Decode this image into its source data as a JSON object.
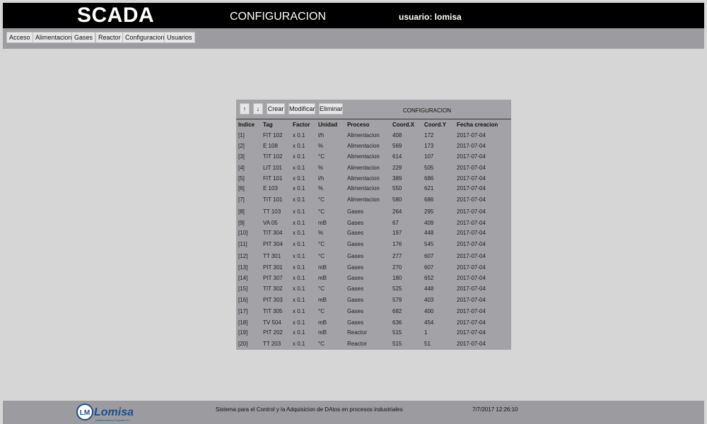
{
  "header": {
    "app_title": "SCADA",
    "page_heading": "CONFIGURACION",
    "user_label": "usuario: lomisa"
  },
  "menu": [
    {
      "label": "Acceso"
    },
    {
      "label": "Alimentacion"
    },
    {
      "label": "Gases"
    },
    {
      "label": "Reactor"
    },
    {
      "label": "Configuracion"
    },
    {
      "label": "Usuarios"
    }
  ],
  "toolbar": {
    "up_label": "↑",
    "down_label": "↓",
    "create_label": "Crear",
    "modify_label": "Modificar",
    "delete_label": "Eliminar",
    "panel_title": "CONFIGURACION"
  },
  "table": {
    "columns": [
      "Indice",
      "Tag",
      "Factor",
      "Unidad",
      "Proceso",
      "Coord.X",
      "Coord.Y",
      "Fecha creacion"
    ],
    "rows": [
      {
        "indice": "[1]",
        "tag": "FIT 102",
        "factor": "x 0.1",
        "unidad": "l/h",
        "proceso": "Alimentacion",
        "x": "408",
        "y": "172",
        "fecha": "2017-07-04"
      },
      {
        "indice": "[2]",
        "tag": "E 108",
        "factor": "x 0.1",
        "unidad": "%",
        "proceso": "Alimentacion",
        "x": "569",
        "y": "173",
        "fecha": "2017-07-04"
      },
      {
        "indice": "[3]",
        "tag": "TIT 102",
        "factor": "x 0.1",
        "unidad": "°C",
        "proceso": "Alimentacion",
        "x": "614",
        "y": "107",
        "fecha": "2017-07-04"
      },
      {
        "indice": "[4]",
        "tag": "LIT 101",
        "factor": "x 0.1",
        "unidad": "%",
        "proceso": "Alimentacion",
        "x": "229",
        "y": "505",
        "fecha": "2017-07-04"
      },
      {
        "indice": "[5]",
        "tag": "FIT 101",
        "factor": "x 0.1",
        "unidad": "l/h",
        "proceso": "Alimentacion",
        "x": "389",
        "y": "686",
        "fecha": "2017-07-04"
      },
      {
        "indice": "[6]",
        "tag": "E 103",
        "factor": "x 0.1",
        "unidad": "%",
        "proceso": "Alimentacion",
        "x": "550",
        "y": "621",
        "fecha": "2017-07-04"
      },
      {
        "indice": "[7]",
        "tag": "TIT 101",
        "factor": "x 0.1",
        "unidad": "°C",
        "proceso": "Alimentacion",
        "x": "580",
        "y": "686",
        "fecha": "2017-07-04"
      },
      {
        "indice": "[8]",
        "tag": "TT 103",
        "factor": "x 0.1",
        "unidad": "°C",
        "proceso": "Gases",
        "x": "264",
        "y": "295",
        "fecha": "2017-07-04"
      },
      {
        "indice": "[9]",
        "tag": "VA 05",
        "factor": "x 0.1",
        "unidad": "mB",
        "proceso": "Gases",
        "x": "67",
        "y": "409",
        "fecha": "2017-07-04"
      },
      {
        "indice": "[10]",
        "tag": "TIT 304",
        "factor": "x 0.1",
        "unidad": "%",
        "proceso": "Gases",
        "x": "197",
        "y": "448",
        "fecha": "2017-07-04"
      },
      {
        "indice": "[11]",
        "tag": "PIT 304",
        "factor": "x 0.1",
        "unidad": "°C",
        "proceso": "Gases",
        "x": "176",
        "y": "545",
        "fecha": "2017-07-04"
      },
      {
        "indice": "[12]",
        "tag": "TT 301",
        "factor": "x 0.1",
        "unidad": "°C",
        "proceso": "Gases",
        "x": "277",
        "y": "607",
        "fecha": "2017-07-04"
      },
      {
        "indice": "[13]",
        "tag": "PIT 301",
        "factor": "x 0.1",
        "unidad": "mB",
        "proceso": "Gases",
        "x": "270",
        "y": "607",
        "fecha": "2017-07-04"
      },
      {
        "indice": "[14]",
        "tag": "PIT 307",
        "factor": "x 0.1",
        "unidad": "mB",
        "proceso": "Gases",
        "x": "180",
        "y": "652",
        "fecha": "2017-07-04"
      },
      {
        "indice": "[15]",
        "tag": "TIT 302",
        "factor": "x 0.1",
        "unidad": "°C",
        "proceso": "Gases",
        "x": "525",
        "y": "448",
        "fecha": "2017-07-04"
      },
      {
        "indice": "[16]",
        "tag": "PIT 303",
        "factor": "x 0.1",
        "unidad": "mB",
        "proceso": "Gases",
        "x": "579",
        "y": "403",
        "fecha": "2017-07-04"
      },
      {
        "indice": "[17]",
        "tag": "TIT 305",
        "factor": "x 0.1",
        "unidad": "°C",
        "proceso": "Gases",
        "x": "682",
        "y": "400",
        "fecha": "2017-07-04"
      },
      {
        "indice": "[18]",
        "tag": "TV 504",
        "factor": "x 0.1",
        "unidad": "mB",
        "proceso": "Gases",
        "x": "636",
        "y": "454",
        "fecha": "2017-07-04"
      },
      {
        "indice": "[19]",
        "tag": "PIT 202",
        "factor": "x 0.1",
        "unidad": "mB",
        "proceso": "Reactor",
        "x": "515",
        "y": "1",
        "fecha": "2017-07-04"
      },
      {
        "indice": "[20]",
        "tag": "TT 203",
        "factor": "x 0.1",
        "unidad": "°C",
        "proceso": "Reactor",
        "x": "515",
        "y": "51",
        "fecha": "2017-07-04"
      }
    ]
  },
  "footer": {
    "logo_text": "Lomisa",
    "logo_subtitle": "Distribuciones y Proyectos S.L.",
    "description": "Sistema para el Control y la Adquisicion de DAtos en procesos industriales",
    "timestamp": "7/7/2017 12:26:10"
  }
}
